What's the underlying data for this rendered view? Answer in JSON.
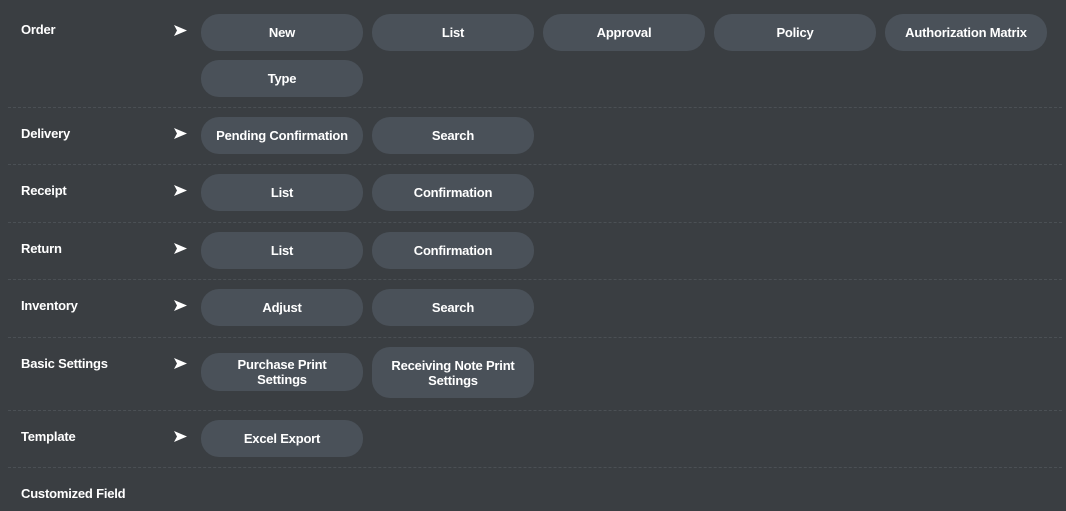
{
  "rows": [
    {
      "label": "Order",
      "buttons": [
        "New",
        "List",
        "Approval",
        "Policy",
        "Authorization Matrix",
        "Type"
      ]
    },
    {
      "label": "Delivery",
      "buttons": [
        "Pending Confirmation",
        "Search"
      ]
    },
    {
      "label": "Receipt",
      "buttons": [
        "List",
        "Confirmation"
      ]
    },
    {
      "label": "Return",
      "buttons": [
        "List",
        "Confirmation"
      ]
    },
    {
      "label": "Inventory",
      "buttons": [
        "Adjust",
        "Search"
      ]
    },
    {
      "label": "Basic Settings",
      "buttons": [
        "Purchase Print Settings",
        "Receiving Note Print Settings"
      ]
    },
    {
      "label": "Template",
      "buttons": [
        "Excel Export"
      ]
    },
    {
      "label": "Customized Field",
      "buttons": []
    }
  ],
  "icons": {
    "row_arrow": "arrow-right-icon"
  },
  "colors": {
    "background": "#3a3e42",
    "button": "#4a5159",
    "text": "#ffffff",
    "divider": "#4b5055"
  }
}
